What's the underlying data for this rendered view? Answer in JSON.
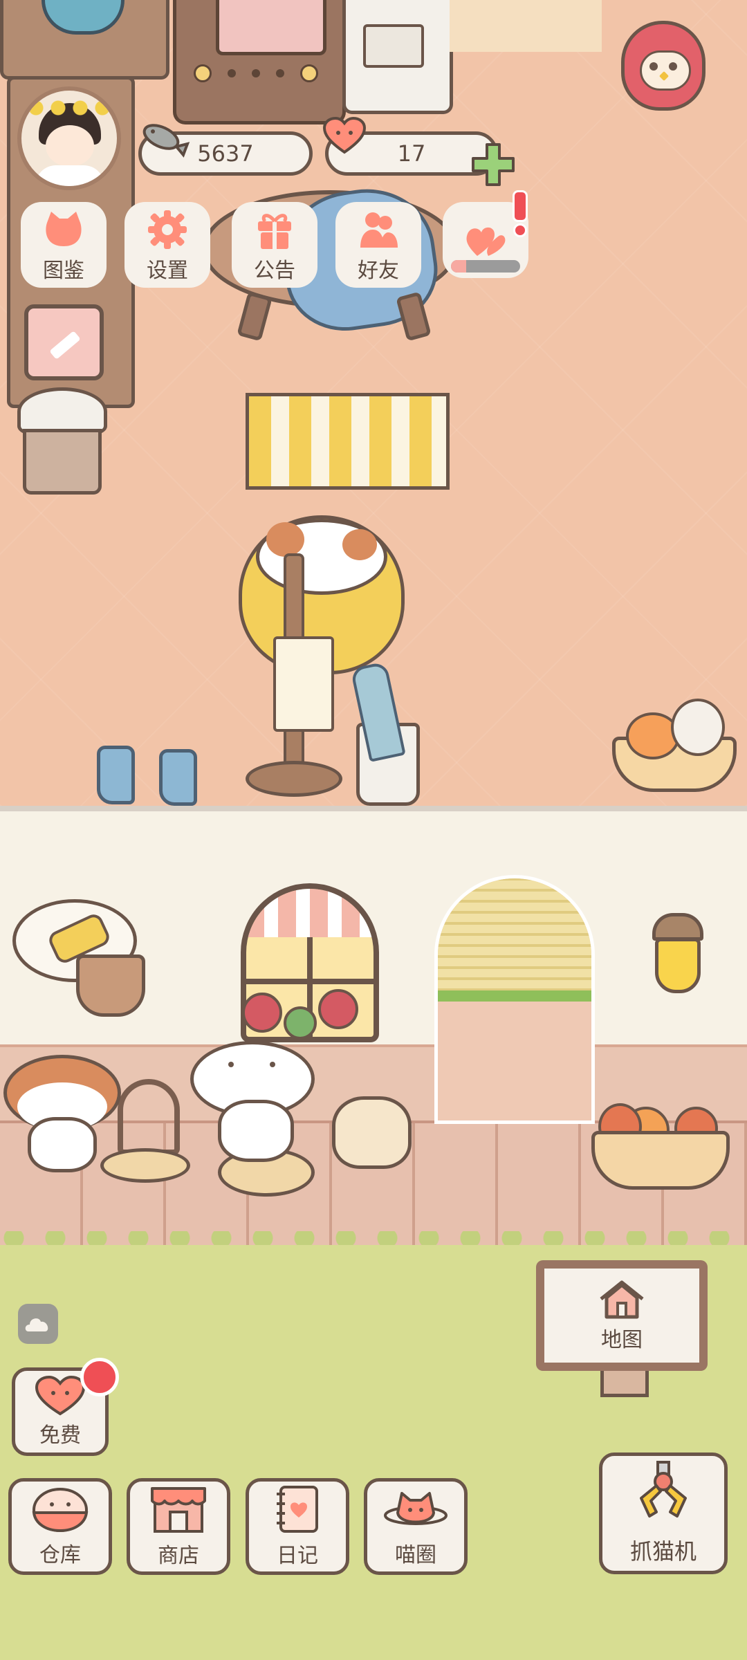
{
  "currency": {
    "fish": "5637",
    "hearts": "17"
  },
  "menu": {
    "encyclopedia": "图鉴",
    "settings": "设置",
    "notice": "公告",
    "friends": "好友"
  },
  "map_label": "地图",
  "free_label": "免费",
  "bottom_nav": {
    "warehouse": "仓库",
    "shop": "商店",
    "diary": "日记",
    "circle": "喵圈"
  },
  "claw_label": "抓猫机",
  "colors": {
    "brand": "#ff8e7a",
    "outline": "#6a5549",
    "notification": "#ef4f55",
    "plus": "#9bd17a"
  },
  "icons": {
    "fish": "fish-icon",
    "heart": "heart-icon",
    "plus": "plus-icon",
    "cat_book": "cat-face-icon",
    "gear": "gear-icon",
    "gift": "gift-icon",
    "friends": "friends-icon",
    "event": "heart-event-icon",
    "pencil": "pencil-icon",
    "cloud": "cloud-icon",
    "house": "house-icon",
    "claw": "claw-icon"
  }
}
